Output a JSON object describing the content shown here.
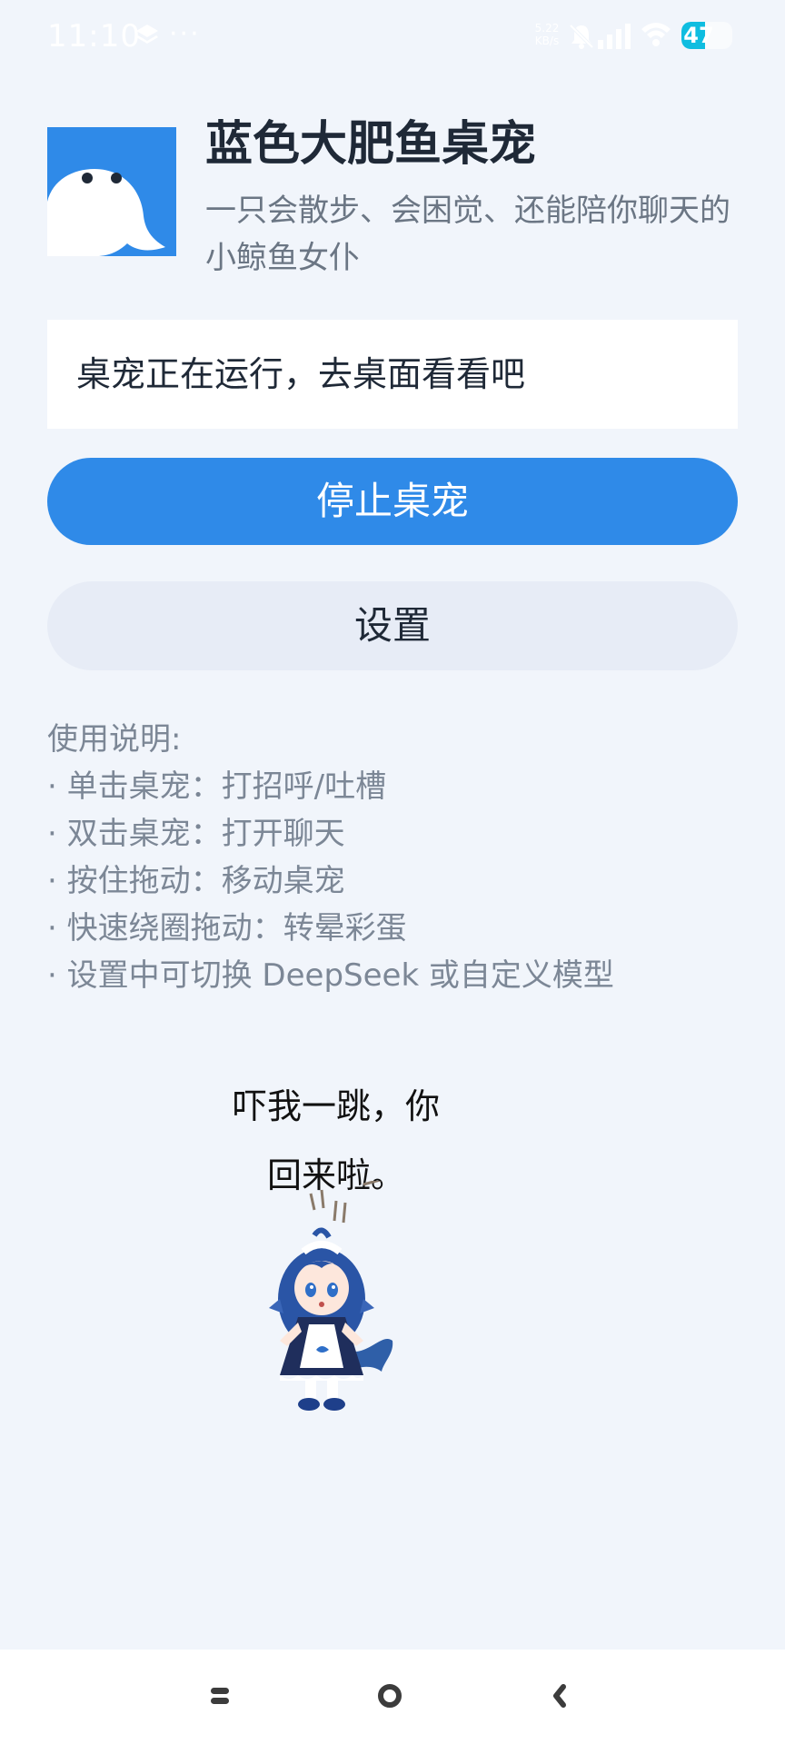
{
  "status_bar": {
    "time": "11:10",
    "dots": "···",
    "network_speed_value": "5.22",
    "network_speed_unit": "KB/s",
    "battery": "47",
    "battery_level": 0.47
  },
  "header": {
    "title": "蓝色大肥鱼桌宠",
    "subtitle": "一只会散步、会困觉、还能陪你聊天的小鲸鱼女仆",
    "logo_icon": "whale-logo-icon",
    "logo_color": "#2f8ae8"
  },
  "status_card": {
    "text": "桌宠正在运行，去桌面看看吧"
  },
  "actions": {
    "stop_label": "停止桌宠",
    "settings_label": "设置"
  },
  "instructions": {
    "title": "使用说明:",
    "items": [
      "· 单击桌宠：打招呼/吐槽",
      "· 双击桌宠：打开聊天",
      "· 按住拖动：移动桌宠",
      "· 快速绕圈拖动：转晕彩蛋",
      "· 设置中可切换 DeepSeek 或自定义模型"
    ]
  },
  "pet": {
    "bubble_line1": "吓我一跳，你",
    "bubble_line2": "回来啦。",
    "figure_icon": "whale-maid-pet-icon"
  },
  "nav_bar": {
    "menu_icon": "menu-icon",
    "home_icon": "home-icon",
    "back_icon": "back-icon"
  },
  "colors": {
    "accent": "#2f8ae8",
    "background": "#f1f5fb",
    "secondary_button": "#e7ecf6",
    "muted_text": "#7c8796"
  }
}
